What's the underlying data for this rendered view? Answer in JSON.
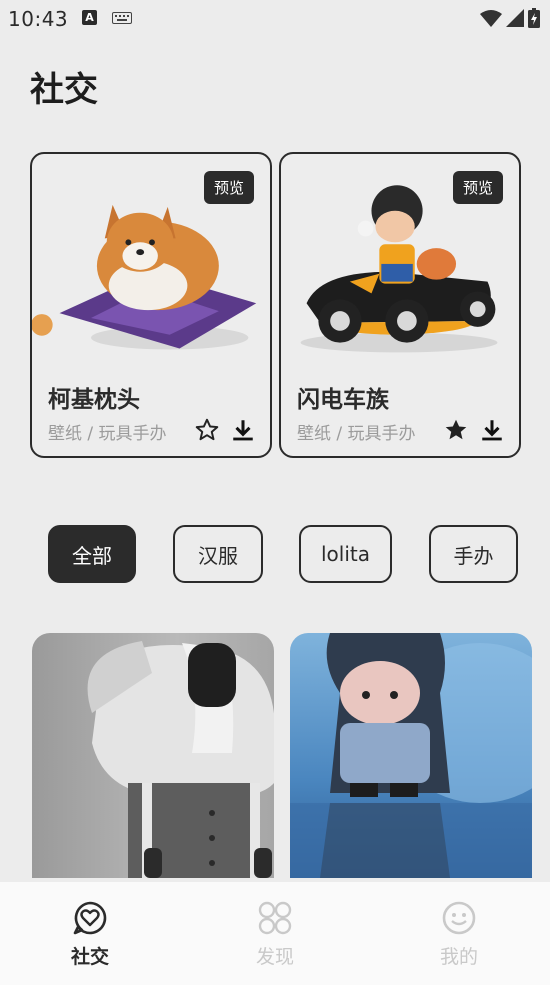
{
  "status_bar": {
    "time": "10:43",
    "input_badge": "A"
  },
  "page": {
    "title": "社交"
  },
  "featured": [
    {
      "title": "柯基枕头",
      "tags": "壁纸 / 玩具手办",
      "badge": "预览",
      "favorited": false
    },
    {
      "title": "闪电车族",
      "tags": "壁纸 / 玩具手办",
      "badge": "预览",
      "favorited": true
    }
  ],
  "categories": [
    {
      "label": "全部",
      "active": true
    },
    {
      "label": "汉服",
      "active": false
    },
    {
      "label": "lolita",
      "active": false
    },
    {
      "label": "手办",
      "active": false
    }
  ],
  "bottom_nav": {
    "items": [
      {
        "label": "社交",
        "icon": "chat-heart-icon",
        "active": true
      },
      {
        "label": "发现",
        "icon": "grid-circles-icon",
        "active": false
      },
      {
        "label": "我的",
        "icon": "smiley-icon",
        "active": false
      }
    ]
  },
  "colors": {
    "dark": "#2b2b2b",
    "background": "#ececec",
    "muted": "#9b9b9b",
    "inactive": "#c9c9c9"
  }
}
